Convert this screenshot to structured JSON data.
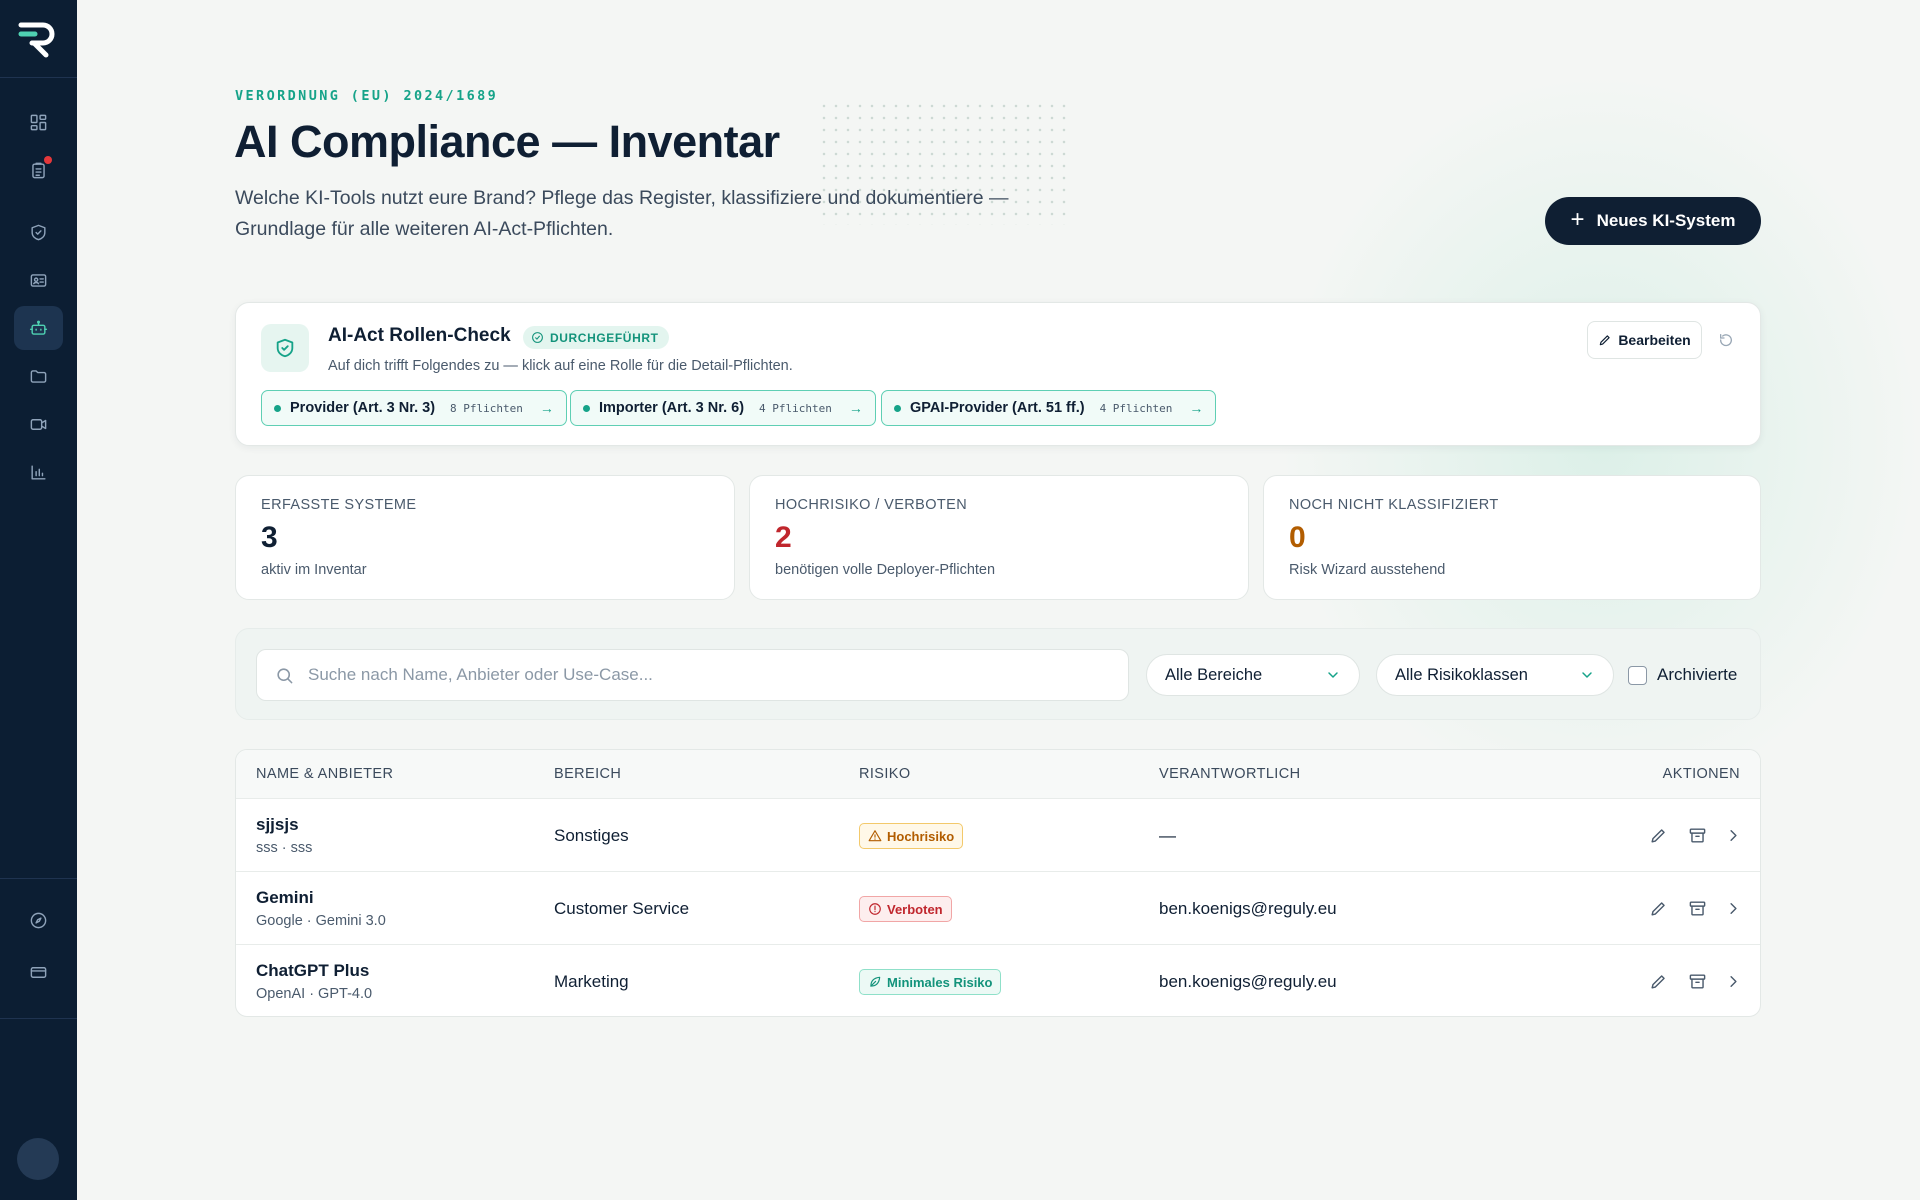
{
  "sidebar": {
    "logo": "R",
    "items": [
      {
        "name": "dashboard-icon"
      },
      {
        "name": "clipboard-icon",
        "notification": true
      },
      {
        "name": "shield-icon"
      },
      {
        "name": "id-card-icon"
      },
      {
        "name": "bot-icon",
        "active": true
      },
      {
        "name": "folder-icon"
      },
      {
        "name": "video-icon"
      },
      {
        "name": "bar-chart-icon"
      }
    ],
    "bottom_items": [
      {
        "name": "compass-icon"
      },
      {
        "name": "credit-card-icon"
      }
    ]
  },
  "header": {
    "eyebrow": "VERORDNUNG (EU) 2024/1689",
    "title": "AI Compliance — Inventar",
    "subtitle": "Welche KI-Tools nutzt eure Brand? Pflege das Register, klassifiziere und dokumentiere — Grundlage für alle weiteren AI-Act-Pflichten.",
    "primary_button": "Neues KI-System"
  },
  "role_check": {
    "title": "AI-Act Rollen-Check",
    "badge": "DURCHGEFÜHRT",
    "description": "Auf dich trifft Folgendes zu — klick auf eine Rolle für die Detail-Pflichten.",
    "edit_label": "Bearbeiten",
    "roles": [
      {
        "label": "Provider (Art. 3 Nr. 3)",
        "count": "8 Pflichten"
      },
      {
        "label": "Importer (Art. 3 Nr. 6)",
        "count": "4 Pflichten"
      },
      {
        "label": "GPAI-Provider (Art. 51 ff.)",
        "count": "4 Pflichten"
      }
    ]
  },
  "stats": [
    {
      "label": "ERFASSTE SYSTEME",
      "value": "3",
      "sub": "aktiv im Inventar",
      "color": "#0f1f33"
    },
    {
      "label": "HOCHRISIKO / VERBOTEN",
      "value": "2",
      "sub": "benötigen volle Deployer-Pflichten",
      "color": "#c0262d"
    },
    {
      "label": "NOCH NICHT KLASSIFIZIERT",
      "value": "0",
      "sub": "Risk Wizard ausstehend",
      "color": "#b25d00"
    }
  ],
  "filters": {
    "search_placeholder": "Suche nach Name, Anbieter oder Use-Case...",
    "area_select": "Alle Bereiche",
    "risk_select": "Alle Risikoklassen",
    "archived_label": "Archivierte"
  },
  "table": {
    "headers": {
      "name": "NAME & ANBIETER",
      "area": "BEREICH",
      "risk": "RISIKO",
      "owner": "VERANTWORTLICH",
      "actions": "AKTIONEN"
    },
    "rows": [
      {
        "name": "sjjsjs",
        "vendor": "sss · sss",
        "area": "Sonstiges",
        "risk": "Hochrisiko",
        "risk_type": "high",
        "owner": "—"
      },
      {
        "name": "Gemini",
        "vendor": "Google · Gemini 3.0",
        "area": "Customer Service",
        "risk": "Verboten",
        "risk_type": "forbidden",
        "owner": "ben.koenigs@reguly.eu"
      },
      {
        "name": "ChatGPT Plus",
        "vendor": "OpenAI · GPT-4.0",
        "area": "Marketing",
        "risk": "Minimales Risiko",
        "risk_type": "minimal",
        "owner": "ben.koenigs@reguly.eu"
      }
    ]
  },
  "colors": {
    "accent": "#16a389",
    "navy": "#0c1e33",
    "danger": "#c0262d",
    "warning": "#b25d00"
  }
}
